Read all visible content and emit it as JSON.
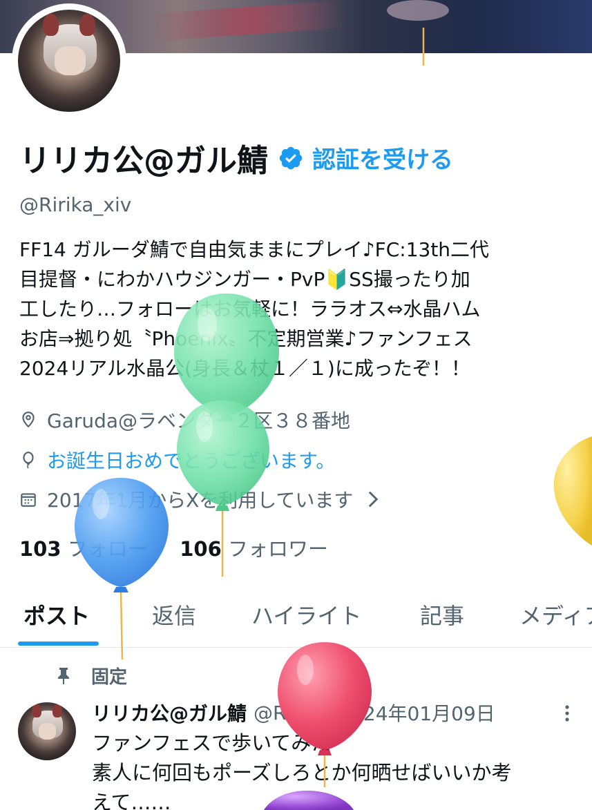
{
  "profile": {
    "display_name": "リリカ公@ガル鯖",
    "verify_link": "認証を受ける",
    "handle": "@Ririka_xiv",
    "bio_lines": [
      "FF14 ガルーダ鯖で自由気ままにプレイ♪FC:13th二代",
      "目提督・にわかハウジンガー・PvP🔰SS撮ったり加",
      "工したり…フォローはお気軽に！ララオス⇔水晶ハム",
      "お店⇒拠り処〝Phoenix〟不定期営業♪ファンフェス",
      "2024リアル水晶公(身長＆杖１／１)に成ったぞ！！"
    ],
    "location": "Garuda@ラベンダー２区３８番地",
    "birthday": "お誕生日おめでとうございます。",
    "joined": "2017年1月からXを利用しています",
    "following_count": "103",
    "following_label": "フォロー",
    "followers_count": "106",
    "followers_label": "フォロワー"
  },
  "tabs": [
    {
      "label": "ポスト"
    },
    {
      "label": "返信"
    },
    {
      "label": "ハイライト"
    },
    {
      "label": "記事"
    },
    {
      "label": "メディア"
    }
  ],
  "pinned_post": {
    "pinned_label": "固定",
    "author_name": "リリカ公@ガル鯖",
    "author_handle": "@Ri…",
    "separator": "・",
    "date": "2024年01月09日",
    "text_lines": [
      "ファンフェスで歩いてみた",
      "素人に何回もポーズしろとか何晒せばいいか考",
      "えて……"
    ]
  },
  "colors": {
    "accent": "#1d9bf0",
    "secondary_text": "#536471",
    "balloon_green": "#6fe0a8",
    "balloon_blue": "#4a9bf0",
    "balloon_red": "#ef4f6e",
    "balloon_yellow": "#f5d24a",
    "balloon_purple": "#9b4fd6"
  },
  "icons": {
    "verified": "verified-badge-icon",
    "location": "location-pin-icon",
    "birthday": "balloon-icon",
    "calendar": "calendar-icon",
    "pin": "pushpin-icon",
    "more": "more-vertical-icon"
  }
}
